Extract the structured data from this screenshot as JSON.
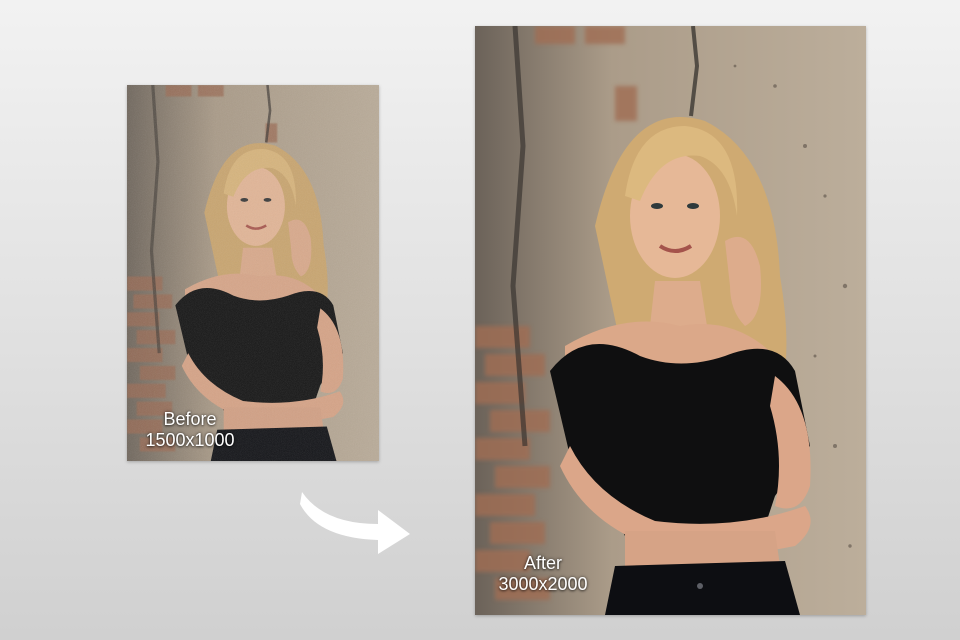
{
  "before": {
    "label": "Before",
    "resolution": "1500x1000"
  },
  "after": {
    "label": "After",
    "resolution": "3000x2000"
  },
  "colors": {
    "background_top": "#f2f2f2",
    "background_bottom": "#d0d0d0",
    "caption_text": "#ffffff",
    "arrow": "#ffffff"
  },
  "icons": {
    "arrow": "curved-arrow-right-icon"
  }
}
